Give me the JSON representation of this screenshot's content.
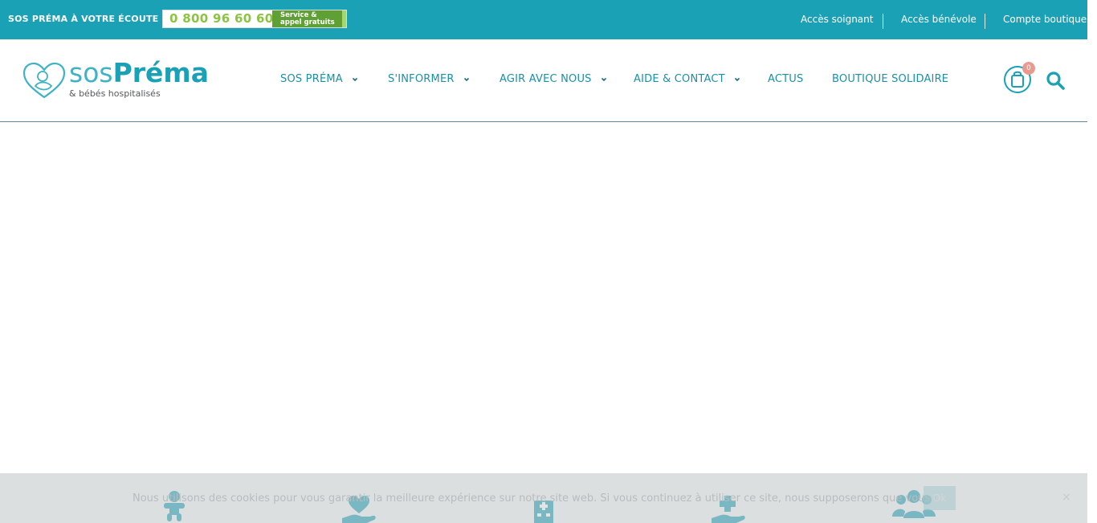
{
  "topbar": {
    "label": "SOS PRÉMA À VOTRE ÉCOUTE :",
    "phone_number": "0 800 96 60 60",
    "phone_note": "Service & appel gratuits",
    "links": [
      {
        "label": "Accès soignant"
      },
      {
        "label": "Accès bénévole"
      },
      {
        "label": "Compte boutique"
      }
    ],
    "bg_color": "#1aa1b5"
  },
  "logo": {
    "word_sos": "sos",
    "word_prema": "Préma",
    "tagline": "& bébés hospitalisés"
  },
  "nav": {
    "items": [
      {
        "label": "SOS PRÉMA",
        "has_dropdown": true
      },
      {
        "label": "S'INFORMER",
        "has_dropdown": true
      },
      {
        "label": "AGIR AVEC NOUS",
        "has_dropdown": true
      },
      {
        "label": "AIDE & CONTACT",
        "has_dropdown": true
      },
      {
        "label": "ACTUS",
        "has_dropdown": false
      },
      {
        "label": "BOUTIQUE SOLIDAIRE",
        "has_dropdown": false
      }
    ],
    "accent_color": "#1a90a6"
  },
  "cart": {
    "count": "0",
    "icon": "shopping-bag-icon"
  },
  "search": {
    "icon": "search-icon"
  },
  "features": {
    "icons": [
      "baby-icon",
      "hand-heart-icon",
      "hospital-icon",
      "hand-medical-icon",
      "group-icon"
    ]
  },
  "cookie": {
    "text": "Nous utilisons des cookies pour vous garantir la meilleure expérience sur notre site web. Si vous continuez à utiliser ce site, nous supposerons que vous en êtes satisfait.",
    "ok_label": "Ok",
    "close_label": "×"
  }
}
